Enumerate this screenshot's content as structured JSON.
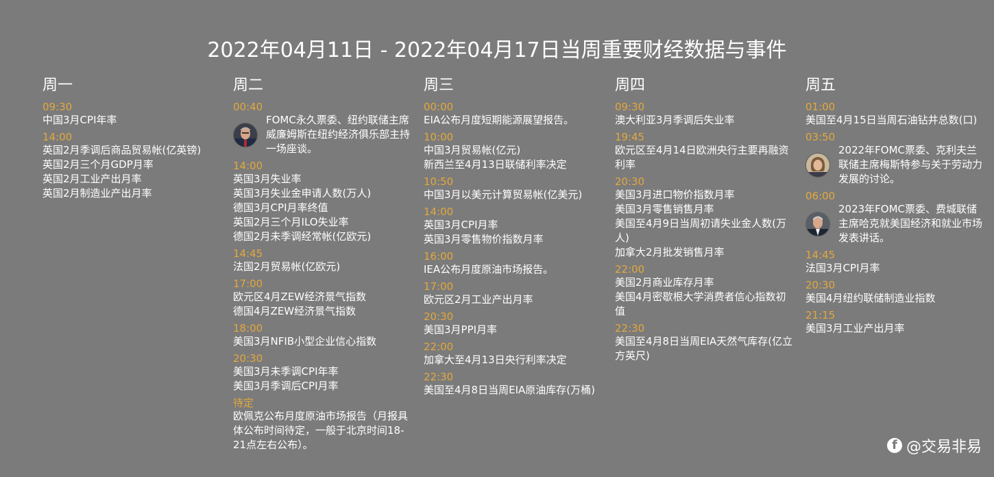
{
  "title": "2022年04月11日 - 2022年04月17日当周重要财经数据与事件",
  "days": [
    {
      "name": "周一",
      "blocks": [
        {
          "time": "09:30",
          "items": [
            "中国3月CPI年率"
          ]
        },
        {
          "time": "14:00",
          "items": [
            "英国2月季调后商品贸易帐(亿英镑)",
            "英国2月三个月GDP月率",
            "英国2月工业产出月率",
            "英国2月制造业产出月率"
          ]
        }
      ]
    },
    {
      "name": "周二",
      "blocks": [
        {
          "time": "00:40",
          "speech": "FOMC永久票委、纽约联储主席威廉姆斯在纽约经济俱乐部主持一场座谈。",
          "avatar": "williams-avatar"
        },
        {
          "time": "14:00",
          "items": [
            "英国3月失业率",
            "英国3月失业金申请人数(万人)",
            "德国3月CPI月率终值",
            "英国2月三个月ILO失业率",
            "德国2月未季调经常帐(亿欧元)"
          ]
        },
        {
          "time": "14:45",
          "items": [
            "法国2月贸易帐(亿欧元)"
          ]
        },
        {
          "time": "17:00",
          "items": [
            "欧元区4月ZEW经济景气指数",
            "德国4月ZEW经济景气指数"
          ]
        },
        {
          "time": "18:00",
          "items": [
            "美国3月NFIB小型企业信心指数"
          ]
        },
        {
          "time": "20:30",
          "items": [
            "美国3月未季调CPI年率",
            "美国3月季调后CPI月率"
          ]
        },
        {
          "time": "待定",
          "items": [
            "欧佩克公布月度原油市场报告（月报具体公布时间待定，一般于北京时间18-21点左右公布）。"
          ]
        }
      ]
    },
    {
      "name": "周三",
      "blocks": [
        {
          "time": "00:00",
          "items": [
            "EIA公布月度短期能源展望报告。"
          ]
        },
        {
          "time": "10:00",
          "items": [
            "中国3月贸易帐(亿元)",
            "新西兰至4月13日联储利率决定"
          ]
        },
        {
          "time": "10:50",
          "items": [
            "中国3月以美元计算贸易帐(亿美元)"
          ]
        },
        {
          "time": "14:00",
          "items": [
            "英国3月CPI月率",
            "英国3月零售物价指数月率"
          ]
        },
        {
          "time": "16:00",
          "items": [
            "IEA公布月度原油市场报告。"
          ]
        },
        {
          "time": "17:00",
          "items": [
            "欧元区2月工业产出月率"
          ]
        },
        {
          "time": "20:30",
          "items": [
            "美国3月PPI月率"
          ]
        },
        {
          "time": "22:00",
          "items": [
            "加拿大至4月13日央行利率决定"
          ]
        },
        {
          "time": "22:30",
          "items": [
            "美国至4月8日当周EIA原油库存(万桶)"
          ]
        }
      ]
    },
    {
      "name": "周四",
      "blocks": [
        {
          "time": "09:30",
          "items": [
            "澳大利亚3月季调后失业率"
          ]
        },
        {
          "time": "19:45",
          "items": [
            "欧元区至4月14日欧洲央行主要再融资利率"
          ]
        },
        {
          "time": "20:30",
          "items": [
            "美国3月进口物价指数月率",
            "美国3月零售销售月率",
            "美国至4月9日当周初请失业金人数(万人)",
            "加拿大2月批发销售月率"
          ]
        },
        {
          "time": "22:00",
          "items": [
            "美国2月商业库存月率",
            "美国4月密歇根大学消费者信心指数初值"
          ]
        },
        {
          "time": "22:30",
          "items": [
            "美国至4月8日当周EIA天然气库存(亿立方英尺)"
          ]
        }
      ]
    },
    {
      "name": "周五",
      "blocks": [
        {
          "time": "01:00",
          "items": [
            "美国至4月15日当周石油钻井总数(口)"
          ]
        },
        {
          "time": "03:50",
          "speech": "2022年FOMC票委、克利夫兰联储主席梅斯特参与关于劳动力发展的讨论。",
          "avatar": "mester-avatar"
        },
        {
          "time": "06:00",
          "speech": "2023年FOMC票委、费城联储主席哈克就美国经济和就业市场发表讲话。",
          "avatar": "harker-avatar"
        },
        {
          "time": "14:45",
          "items": [
            "法国3月CPI月率"
          ]
        },
        {
          "time": "20:30",
          "items": [
            "美国4月纽约联储制造业指数"
          ]
        },
        {
          "time": "21:15",
          "items": [
            "美国3月工业产出月率"
          ]
        }
      ]
    }
  ],
  "watermark": {
    "icon": "facebook-icon",
    "text": "@交易非易"
  },
  "colors": {
    "background": "#7b7b7b",
    "time": "#e3a83c",
    "text": "#ffffff"
  }
}
